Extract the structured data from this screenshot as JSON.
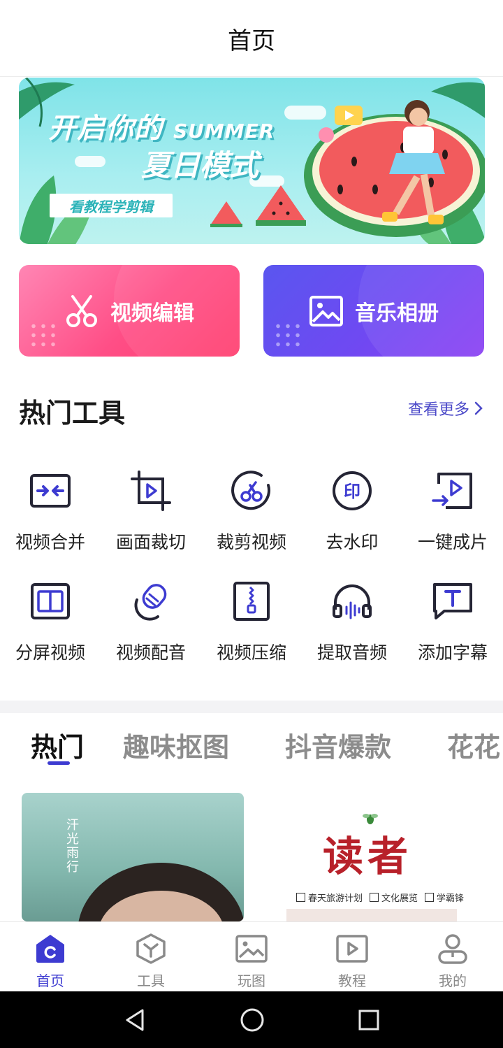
{
  "header": {
    "title": "首页"
  },
  "banner": {
    "line1_cn": "开启你的",
    "line1_en": "SUMMER",
    "line2": "夏日模式",
    "pill": "看教程学剪辑",
    "colors": {
      "sky": "#7fe3e8",
      "accent": "#2bb3b8"
    }
  },
  "quick_actions": [
    {
      "label": "视频编辑",
      "icon": "scissors-icon",
      "color": "#ff4e86"
    },
    {
      "label": "音乐相册",
      "icon": "image-icon",
      "color": "#6f49f2"
    }
  ],
  "hot_tools": {
    "title": "热门工具",
    "more": "查看更多",
    "items": [
      {
        "label": "视频合并",
        "icon": "merge-icon"
      },
      {
        "label": "画面裁切",
        "icon": "crop-icon"
      },
      {
        "label": "裁剪视频",
        "icon": "cut-video-icon"
      },
      {
        "label": "去水印",
        "icon": "watermark-icon"
      },
      {
        "label": "一键成片",
        "icon": "one-click-icon"
      },
      {
        "label": "分屏视频",
        "icon": "split-screen-icon"
      },
      {
        "label": "视频配音",
        "icon": "dubbing-icon"
      },
      {
        "label": "视频压缩",
        "icon": "compress-icon"
      },
      {
        "label": "提取音频",
        "icon": "headphones-icon"
      },
      {
        "label": "添加字幕",
        "icon": "subtitle-icon"
      }
    ]
  },
  "tabs": {
    "items": [
      "热门",
      "趣味抠图",
      "抖音爆款",
      "花花"
    ],
    "active_index": 0,
    "accent": "#3d3bd1"
  },
  "feed": {
    "left_caption": "汗光雨行",
    "right_logo": "读者",
    "right_options": [
      "春天旅游计划",
      "文化展览",
      "学霸锋"
    ]
  },
  "bottom_nav": {
    "items": [
      {
        "label": "首页",
        "icon": "home-icon"
      },
      {
        "label": "工具",
        "icon": "tools-icon"
      },
      {
        "label": "玩图",
        "icon": "gallery-icon"
      },
      {
        "label": "教程",
        "icon": "tutorial-icon"
      },
      {
        "label": "我的",
        "icon": "profile-icon"
      }
    ],
    "active_index": 0
  },
  "system_nav": {
    "icons": [
      "back-icon",
      "home-circle-icon",
      "recents-icon"
    ]
  }
}
